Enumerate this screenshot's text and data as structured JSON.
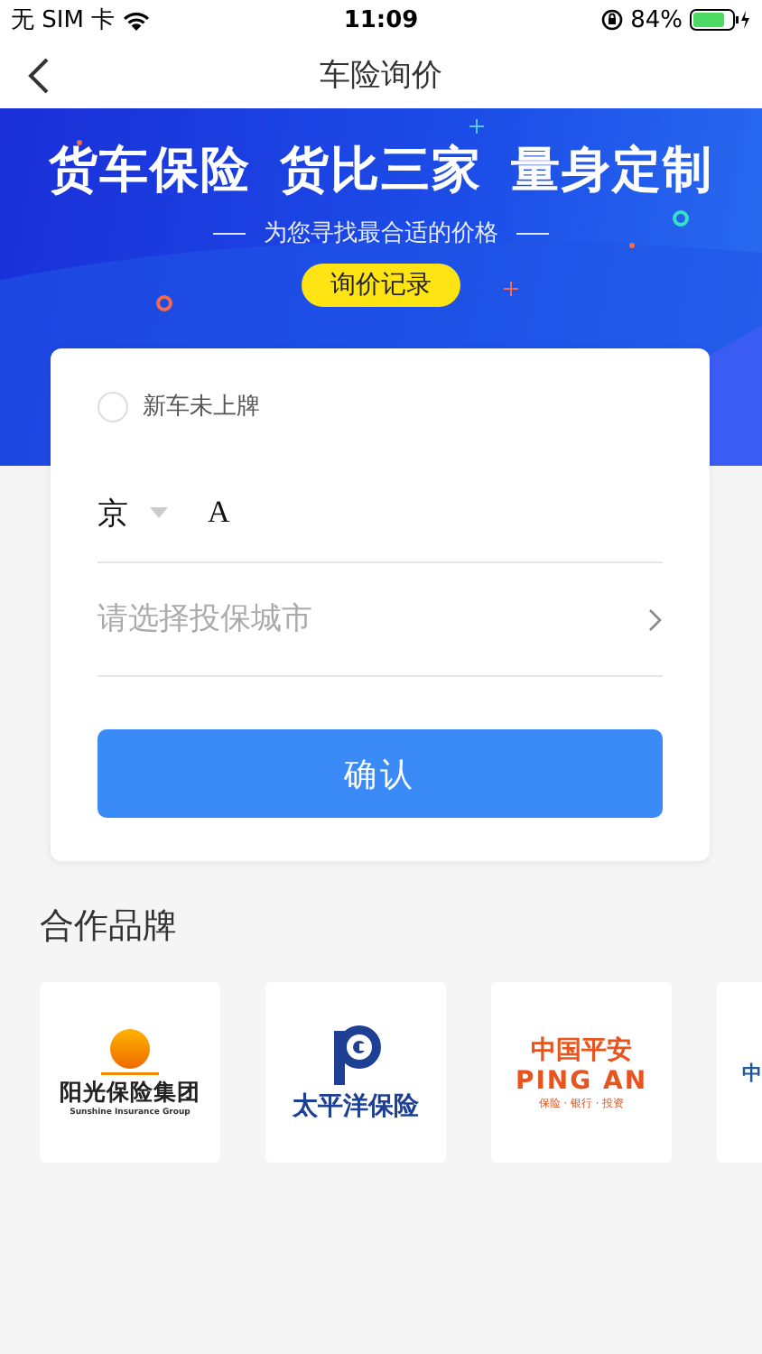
{
  "status_bar": {
    "carrier": "无 SIM 卡",
    "time": "11:09",
    "battery": "84%"
  },
  "nav": {
    "title": "车险询价"
  },
  "banner": {
    "headlines": [
      "货车保险",
      "货比三家",
      "量身定制"
    ],
    "tagline": "为您寻找最合适的价格",
    "button": "询价记录"
  },
  "form": {
    "new_car": {
      "label": "新车未上牌",
      "checked": false
    },
    "province": "京",
    "plate_letter": "A",
    "city": {
      "placeholder": "请选择投保城市"
    },
    "confirm": "确认"
  },
  "partners": {
    "title": "合作品牌",
    "brands": [
      {
        "kind": "sunshine",
        "name": "阳光保险集团",
        "subtitle": "Sunshine Insurance Group"
      },
      {
        "kind": "cpic",
        "name": "太平洋保险"
      },
      {
        "kind": "pingan",
        "name": "中国平安",
        "subtitle": "PING AN",
        "tagline": "保险 · 银行 · 投资"
      },
      {
        "kind": "partial",
        "name": "中"
      }
    ]
  }
}
